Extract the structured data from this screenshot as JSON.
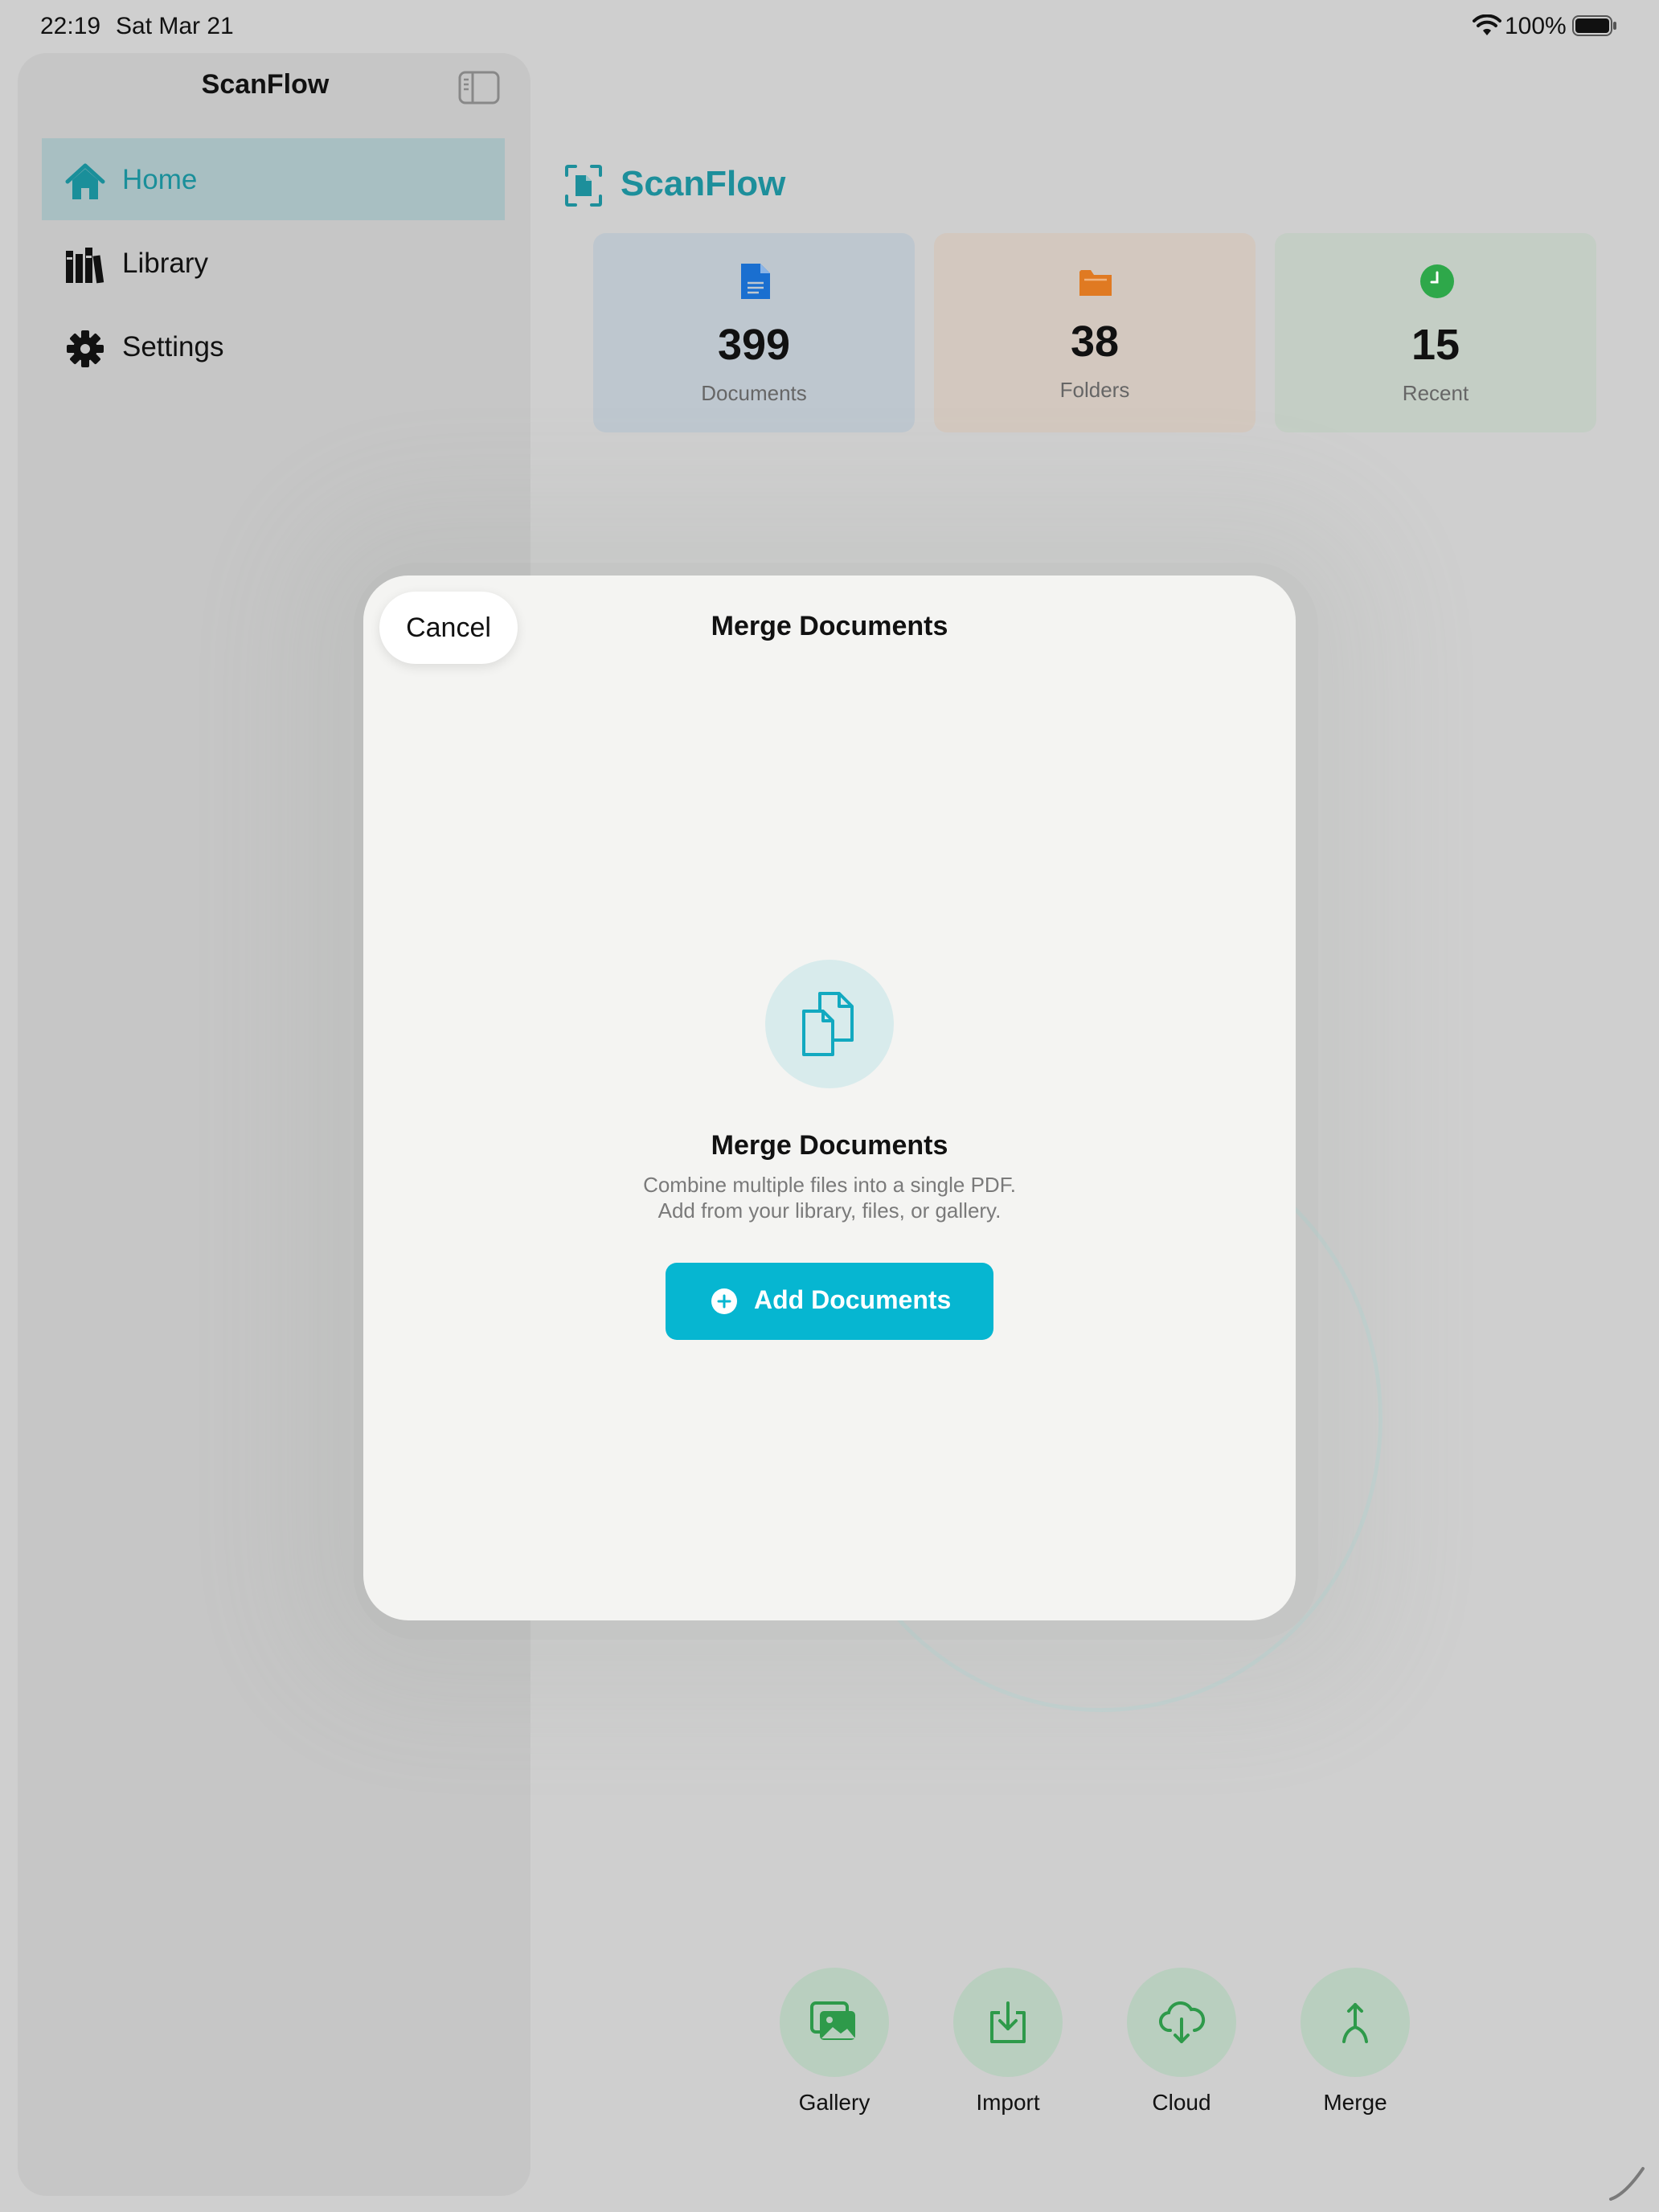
{
  "status_bar": {
    "time": "22:19",
    "date": "Sat Mar 21",
    "battery_percent": "100%"
  },
  "sidebar": {
    "title": "ScanFlow",
    "items": [
      {
        "label": "Home",
        "icon": "house-icon",
        "active": true
      },
      {
        "label": "Library",
        "icon": "books-icon",
        "active": false
      },
      {
        "label": "Settings",
        "icon": "gear-icon",
        "active": false
      }
    ]
  },
  "main": {
    "title": "ScanFlow",
    "stats": [
      {
        "value": "399",
        "label": "Documents",
        "icon": "document-icon",
        "color": "#1a6fd0",
        "bg": "#bec7cf"
      },
      {
        "value": "38",
        "label": "Folders",
        "icon": "folder-icon",
        "color": "#e07a22",
        "bg": "#d3c8bf"
      },
      {
        "value": "15",
        "label": "Recent",
        "icon": "clock-icon",
        "color": "#2ea84a",
        "bg": "#c4cec5"
      }
    ],
    "actions": [
      {
        "label": "Gallery",
        "icon": "photos-icon"
      },
      {
        "label": "Import",
        "icon": "import-tray-icon"
      },
      {
        "label": "Cloud",
        "icon": "cloud-download-icon"
      },
      {
        "label": "Merge",
        "icon": "merge-arrow-icon"
      }
    ]
  },
  "modal": {
    "cancel_label": "Cancel",
    "title": "Merge Documents",
    "empty_title": "Merge Documents",
    "empty_line1": "Combine multiple files into a single PDF.",
    "empty_line2": "Add from your library, files, or gallery.",
    "add_button_label": "Add Documents"
  },
  "colors": {
    "accent": "#06b6d1",
    "brand_teal": "#1d8f9b",
    "action_green": "#2e9a4a"
  }
}
